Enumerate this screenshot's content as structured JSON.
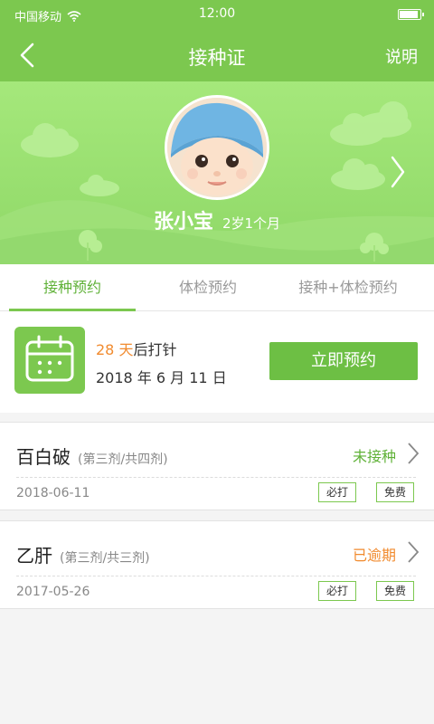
{
  "status_bar": {
    "carrier": "中国移动",
    "time": "12:00"
  },
  "nav": {
    "title": "接种证",
    "help": "说明"
  },
  "child": {
    "name": "张小宝",
    "age": "2岁1个月"
  },
  "tabs": [
    {
      "label": "接种预约",
      "active": true
    },
    {
      "label": "体检预约",
      "active": false
    },
    {
      "label": "接种+体检预约",
      "active": false
    }
  ],
  "appointment": {
    "days": "28 天",
    "days_suffix": "后打针",
    "date": "2018 年 6 月 11 日",
    "book_label": "立即预约"
  },
  "vaccines": [
    {
      "name": "百白破",
      "dose": "(第三剂/共四剂)",
      "status": "未接种",
      "status_color": "#5fb137",
      "date": "2018-06-11",
      "tags": [
        "必打",
        "免费"
      ]
    },
    {
      "name": "乙肝",
      "dose": "(第三剂/共三剂)",
      "status": "已逾期",
      "status_color": "#f18b2f",
      "date": "2017-05-26",
      "tags": [
        "必打",
        "免费"
      ]
    }
  ],
  "colors": {
    "primary": "#7cc84f",
    "accent": "#f18b2f"
  }
}
